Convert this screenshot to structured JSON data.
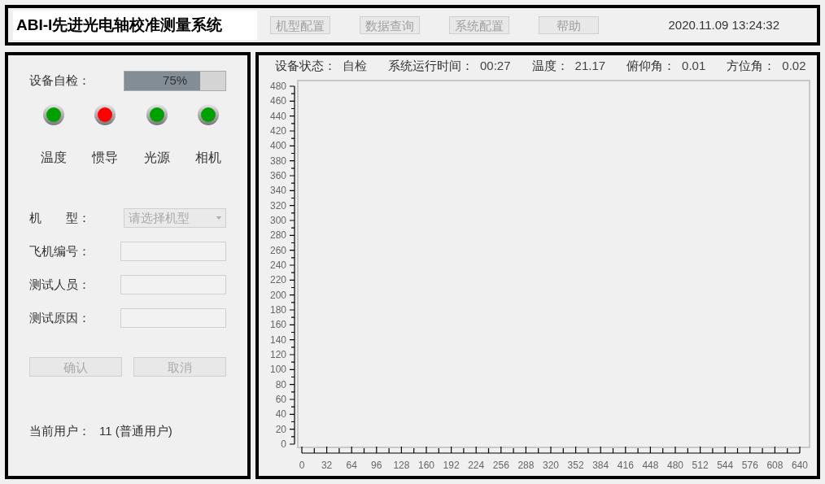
{
  "header": {
    "title": "ABI-I先进光电轴校准测量系统",
    "menu": [
      {
        "label": "机型配置",
        "disabled": true
      },
      {
        "label": "数据查询",
        "disabled": true
      },
      {
        "label": "系统配置",
        "disabled": true
      },
      {
        "label": "帮助",
        "disabled": true
      }
    ],
    "datetime": "2020.11.09 13:24:32"
  },
  "self_check": {
    "label": "设备自检：",
    "level": 0.75,
    "reading": "75%",
    "indicators": [
      {
        "label": "温度",
        "color": "#00a000"
      },
      {
        "label": "惯导",
        "color": "#ff0000"
      },
      {
        "label": "光源",
        "color": "#00a000"
      },
      {
        "label": "相机",
        "color": "#00a000"
      }
    ]
  },
  "form": {
    "fields": [
      {
        "kind": "select",
        "label": "机　　型：",
        "placeholder": "请选择机型",
        "disabled": true
      },
      {
        "kind": "text",
        "label": "飞机编号："
      },
      {
        "kind": "text",
        "label": "测试人员："
      },
      {
        "kind": "text",
        "label": "测试原因："
      }
    ],
    "buttons": [
      {
        "label": "确认",
        "disabled": true
      },
      {
        "label": "取消",
        "disabled": true
      }
    ]
  },
  "current_user": {
    "label": "当前用户：",
    "value": "11 (普通用户)"
  },
  "status": [
    {
      "label": "设备状态：",
      "value": "自检"
    },
    {
      "label": "系统运行时间：",
      "value": "00:27"
    },
    {
      "label": "温度：",
      "value": "21.17"
    },
    {
      "label": "俯仰角：",
      "value": "0.01"
    },
    {
      "label": "方位角：",
      "value": "0.02"
    }
  ],
  "chart_data": {
    "type": "line",
    "xlim": [
      0,
      640
    ],
    "ylim": [
      0,
      480
    ],
    "xticks": [
      0,
      32,
      64,
      96,
      128,
      160,
      192,
      224,
      256,
      288,
      320,
      352,
      384,
      416,
      448,
      480,
      512,
      544,
      576,
      608,
      640
    ],
    "yticks": [
      0,
      20,
      40,
      60,
      80,
      100,
      120,
      140,
      160,
      180,
      200,
      220,
      240,
      260,
      280,
      300,
      320,
      340,
      360,
      380,
      400,
      420,
      440,
      460,
      480
    ]
  }
}
